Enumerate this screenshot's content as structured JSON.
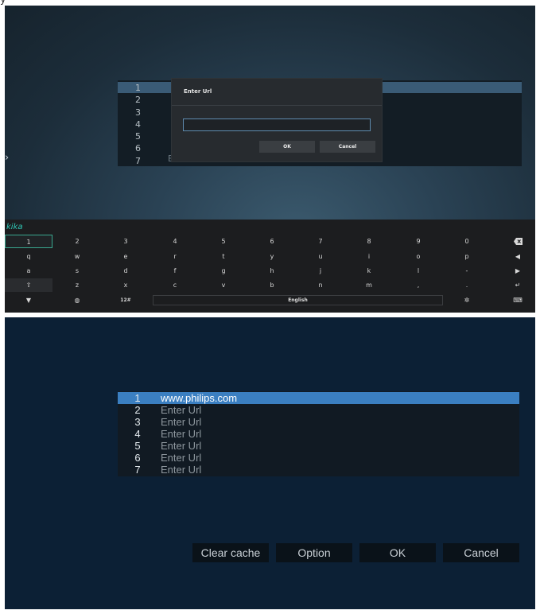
{
  "top": {
    "partial_title": "y",
    "url_numbers": [
      "1",
      "2",
      "3",
      "4",
      "5",
      "6",
      "7"
    ],
    "url_tail_text": "Enter Url",
    "dialog": {
      "title": "Enter Url",
      "input_value": "",
      "ok_label": "OK",
      "cancel_label": "Cancel"
    },
    "keyboard": {
      "brand": "kika",
      "row1": [
        "1",
        "2",
        "3",
        "4",
        "5",
        "6",
        "7",
        "8",
        "9",
        "0"
      ],
      "row2": [
        "q",
        "w",
        "e",
        "r",
        "t",
        "y",
        "u",
        "i",
        "o",
        "p"
      ],
      "row3": [
        "a",
        "s",
        "d",
        "f",
        "g",
        "h",
        "j",
        "k",
        "l",
        "-"
      ],
      "row4": [
        "z",
        "x",
        "c",
        "v",
        "b",
        "n",
        "m",
        ",",
        "."
      ],
      "bottom_12_label": "12#",
      "space_label": "English",
      "icons": {
        "backspace": "backspace-icon",
        "left": "arrow-left-icon",
        "right": "arrow-right-icon",
        "enter": "enter-icon",
        "shift": "shift-icon",
        "hide": "hide-keyboard-icon",
        "globe": "globe-icon",
        "settings": "gear-icon",
        "keyboard": "keyboard-icon"
      }
    }
  },
  "bottom": {
    "urls": [
      {
        "num": "1",
        "text": "www.philips.com",
        "selected": true
      },
      {
        "num": "2",
        "text": "Enter Url",
        "selected": false
      },
      {
        "num": "3",
        "text": "Enter Url",
        "selected": false
      },
      {
        "num": "4",
        "text": "Enter Url",
        "selected": false
      },
      {
        "num": "5",
        "text": "Enter Url",
        "selected": false
      },
      {
        "num": "6",
        "text": "Enter Url",
        "selected": false
      },
      {
        "num": "7",
        "text": "Enter Url",
        "selected": false
      }
    ],
    "buttons": {
      "clear_cache": "Clear cache",
      "option": "Option",
      "ok": "OK",
      "cancel": "Cancel"
    }
  },
  "colors": {
    "selected_row": "#3b7fc1",
    "kika_brand": "#2fc7b5",
    "bottom_bg": "#0c2035"
  }
}
